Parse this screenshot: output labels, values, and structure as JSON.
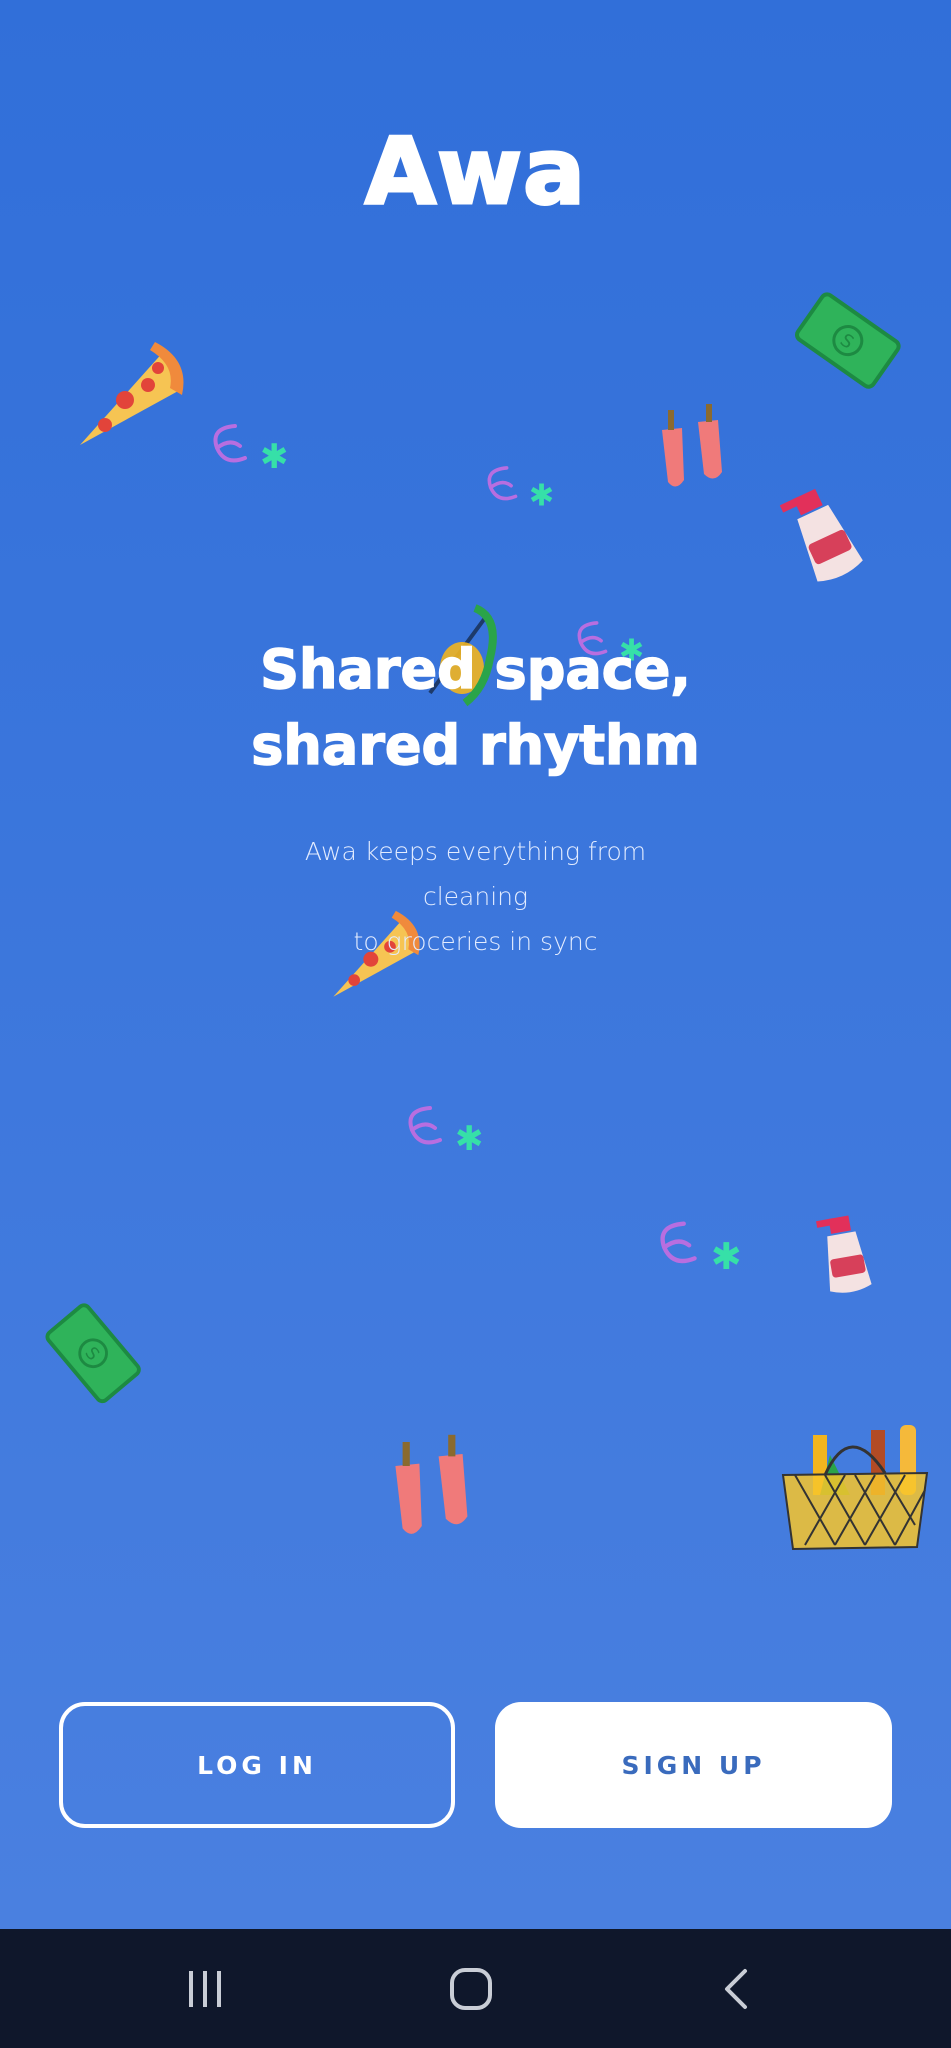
{
  "app": {
    "logo_text": "Awa",
    "headline_line1": "Shared space,",
    "headline_line2": "shared rhythm",
    "subtitle_line1": "Awa keeps everything from cleaning",
    "subtitle_line2": "to groceries in sync"
  },
  "actions": {
    "login_label": "LOG IN",
    "signup_label": "SIGN UP"
  },
  "colors": {
    "background_top": "#316fd9",
    "background_bottom": "#4a80e0",
    "signup_text": "#3a6bbd",
    "navbar": "#0f172b"
  },
  "decorations": [
    "pizza-slice-icon",
    "money-bill-icon",
    "squiggle-star-icon",
    "rubber-gloves-icon",
    "spray-bottle-icon",
    "grocery-basket-icon",
    "broom-icon"
  ],
  "navigation_bar": {
    "icons": [
      "recent-apps-icon",
      "home-icon",
      "back-icon"
    ]
  }
}
